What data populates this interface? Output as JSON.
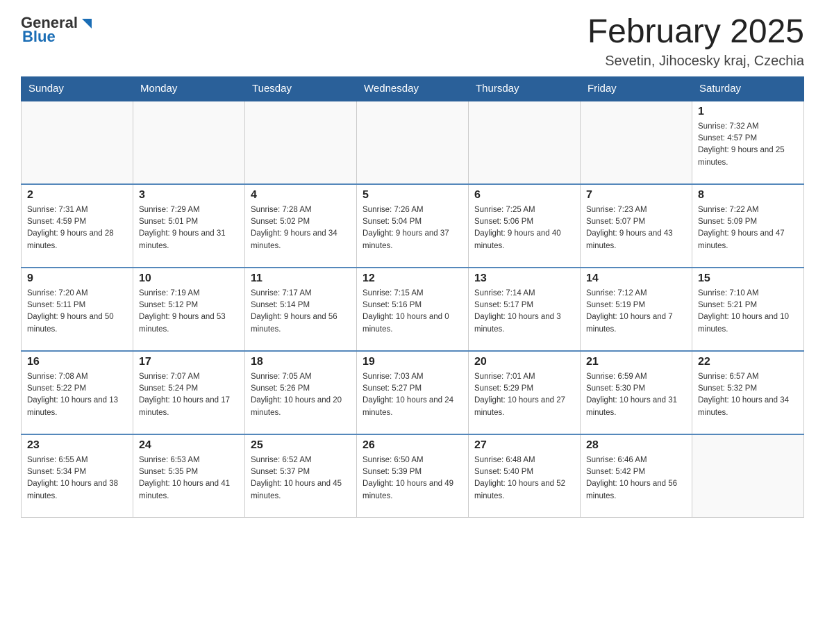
{
  "header": {
    "logo_general": "General",
    "logo_blue": "Blue",
    "month_title": "February 2025",
    "location": "Sevetin, Jihocesky kraj, Czechia"
  },
  "weekdays": [
    "Sunday",
    "Monday",
    "Tuesday",
    "Wednesday",
    "Thursday",
    "Friday",
    "Saturday"
  ],
  "weeks": [
    [
      {
        "day": "",
        "sunrise": "",
        "sunset": "",
        "daylight": ""
      },
      {
        "day": "",
        "sunrise": "",
        "sunset": "",
        "daylight": ""
      },
      {
        "day": "",
        "sunrise": "",
        "sunset": "",
        "daylight": ""
      },
      {
        "day": "",
        "sunrise": "",
        "sunset": "",
        "daylight": ""
      },
      {
        "day": "",
        "sunrise": "",
        "sunset": "",
        "daylight": ""
      },
      {
        "day": "",
        "sunrise": "",
        "sunset": "",
        "daylight": ""
      },
      {
        "day": "1",
        "sunrise": "Sunrise: 7:32 AM",
        "sunset": "Sunset: 4:57 PM",
        "daylight": "Daylight: 9 hours and 25 minutes."
      }
    ],
    [
      {
        "day": "2",
        "sunrise": "Sunrise: 7:31 AM",
        "sunset": "Sunset: 4:59 PM",
        "daylight": "Daylight: 9 hours and 28 minutes."
      },
      {
        "day": "3",
        "sunrise": "Sunrise: 7:29 AM",
        "sunset": "Sunset: 5:01 PM",
        "daylight": "Daylight: 9 hours and 31 minutes."
      },
      {
        "day": "4",
        "sunrise": "Sunrise: 7:28 AM",
        "sunset": "Sunset: 5:02 PM",
        "daylight": "Daylight: 9 hours and 34 minutes."
      },
      {
        "day": "5",
        "sunrise": "Sunrise: 7:26 AM",
        "sunset": "Sunset: 5:04 PM",
        "daylight": "Daylight: 9 hours and 37 minutes."
      },
      {
        "day": "6",
        "sunrise": "Sunrise: 7:25 AM",
        "sunset": "Sunset: 5:06 PM",
        "daylight": "Daylight: 9 hours and 40 minutes."
      },
      {
        "day": "7",
        "sunrise": "Sunrise: 7:23 AM",
        "sunset": "Sunset: 5:07 PM",
        "daylight": "Daylight: 9 hours and 43 minutes."
      },
      {
        "day": "8",
        "sunrise": "Sunrise: 7:22 AM",
        "sunset": "Sunset: 5:09 PM",
        "daylight": "Daylight: 9 hours and 47 minutes."
      }
    ],
    [
      {
        "day": "9",
        "sunrise": "Sunrise: 7:20 AM",
        "sunset": "Sunset: 5:11 PM",
        "daylight": "Daylight: 9 hours and 50 minutes."
      },
      {
        "day": "10",
        "sunrise": "Sunrise: 7:19 AM",
        "sunset": "Sunset: 5:12 PM",
        "daylight": "Daylight: 9 hours and 53 minutes."
      },
      {
        "day": "11",
        "sunrise": "Sunrise: 7:17 AM",
        "sunset": "Sunset: 5:14 PM",
        "daylight": "Daylight: 9 hours and 56 minutes."
      },
      {
        "day": "12",
        "sunrise": "Sunrise: 7:15 AM",
        "sunset": "Sunset: 5:16 PM",
        "daylight": "Daylight: 10 hours and 0 minutes."
      },
      {
        "day": "13",
        "sunrise": "Sunrise: 7:14 AM",
        "sunset": "Sunset: 5:17 PM",
        "daylight": "Daylight: 10 hours and 3 minutes."
      },
      {
        "day": "14",
        "sunrise": "Sunrise: 7:12 AM",
        "sunset": "Sunset: 5:19 PM",
        "daylight": "Daylight: 10 hours and 7 minutes."
      },
      {
        "day": "15",
        "sunrise": "Sunrise: 7:10 AM",
        "sunset": "Sunset: 5:21 PM",
        "daylight": "Daylight: 10 hours and 10 minutes."
      }
    ],
    [
      {
        "day": "16",
        "sunrise": "Sunrise: 7:08 AM",
        "sunset": "Sunset: 5:22 PM",
        "daylight": "Daylight: 10 hours and 13 minutes."
      },
      {
        "day": "17",
        "sunrise": "Sunrise: 7:07 AM",
        "sunset": "Sunset: 5:24 PM",
        "daylight": "Daylight: 10 hours and 17 minutes."
      },
      {
        "day": "18",
        "sunrise": "Sunrise: 7:05 AM",
        "sunset": "Sunset: 5:26 PM",
        "daylight": "Daylight: 10 hours and 20 minutes."
      },
      {
        "day": "19",
        "sunrise": "Sunrise: 7:03 AM",
        "sunset": "Sunset: 5:27 PM",
        "daylight": "Daylight: 10 hours and 24 minutes."
      },
      {
        "day": "20",
        "sunrise": "Sunrise: 7:01 AM",
        "sunset": "Sunset: 5:29 PM",
        "daylight": "Daylight: 10 hours and 27 minutes."
      },
      {
        "day": "21",
        "sunrise": "Sunrise: 6:59 AM",
        "sunset": "Sunset: 5:30 PM",
        "daylight": "Daylight: 10 hours and 31 minutes."
      },
      {
        "day": "22",
        "sunrise": "Sunrise: 6:57 AM",
        "sunset": "Sunset: 5:32 PM",
        "daylight": "Daylight: 10 hours and 34 minutes."
      }
    ],
    [
      {
        "day": "23",
        "sunrise": "Sunrise: 6:55 AM",
        "sunset": "Sunset: 5:34 PM",
        "daylight": "Daylight: 10 hours and 38 minutes."
      },
      {
        "day": "24",
        "sunrise": "Sunrise: 6:53 AM",
        "sunset": "Sunset: 5:35 PM",
        "daylight": "Daylight: 10 hours and 41 minutes."
      },
      {
        "day": "25",
        "sunrise": "Sunrise: 6:52 AM",
        "sunset": "Sunset: 5:37 PM",
        "daylight": "Daylight: 10 hours and 45 minutes."
      },
      {
        "day": "26",
        "sunrise": "Sunrise: 6:50 AM",
        "sunset": "Sunset: 5:39 PM",
        "daylight": "Daylight: 10 hours and 49 minutes."
      },
      {
        "day": "27",
        "sunrise": "Sunrise: 6:48 AM",
        "sunset": "Sunset: 5:40 PM",
        "daylight": "Daylight: 10 hours and 52 minutes."
      },
      {
        "day": "28",
        "sunrise": "Sunrise: 6:46 AM",
        "sunset": "Sunset: 5:42 PM",
        "daylight": "Daylight: 10 hours and 56 minutes."
      },
      {
        "day": "",
        "sunrise": "",
        "sunset": "",
        "daylight": ""
      }
    ]
  ]
}
